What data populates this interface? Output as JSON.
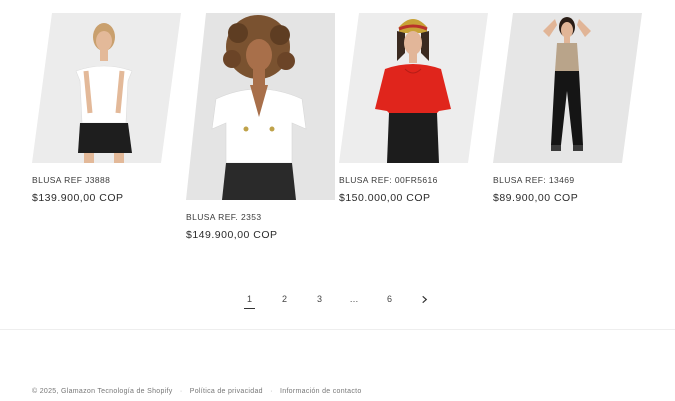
{
  "products": [
    {
      "title": "BLUSA REF J3888",
      "price": "$139.900,00 COP",
      "image": "woman-white-offshoulder-top"
    },
    {
      "title": "BLUSA REF. 2353",
      "price": "$149.900,00 COP",
      "image": "woman-white-ruffle-blouse"
    },
    {
      "title": "BLUSA REF: 00FR5616",
      "price": "$150.000,00 COP",
      "image": "woman-red-blouse"
    },
    {
      "title": "BLUSA REF: 13469",
      "price": "$89.900,00 COP",
      "image": "woman-beige-tank-top"
    }
  ],
  "pagination": {
    "pages": [
      "1",
      "2",
      "3",
      "…",
      "6"
    ],
    "current": "1"
  },
  "footer": {
    "copyright": "© 2025, Glamazon Tecnología de Shopify",
    "privacy": "Política de privacidad",
    "contact": "Información de contacto"
  }
}
